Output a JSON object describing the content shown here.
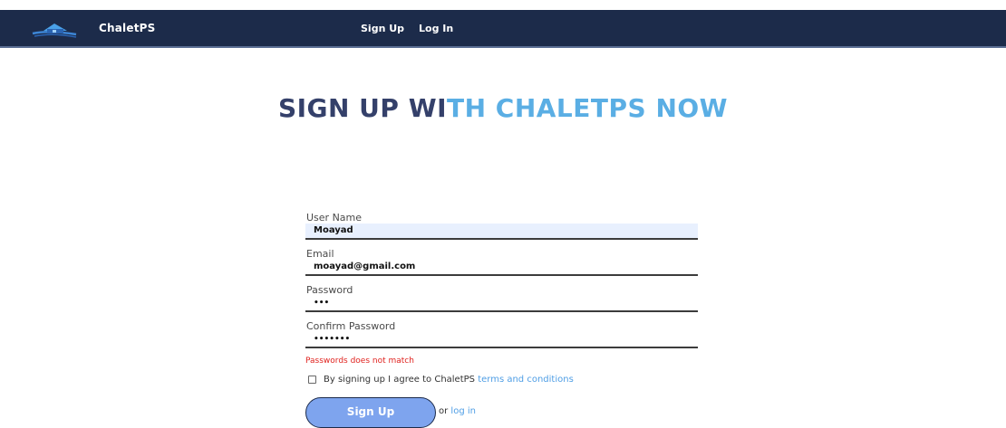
{
  "navbar": {
    "brand": "ChaletPS",
    "links": [
      "Sign Up",
      "Log In"
    ]
  },
  "hero": {
    "title_part_a": "SIGN UP WI",
    "title_part_b": "TH CHALETPS NOW"
  },
  "form": {
    "username": {
      "label": "User Name",
      "value": "Moayad"
    },
    "email": {
      "label": "Email",
      "value": "moayad@gmail.com"
    },
    "password": {
      "label": "Password",
      "value": "•••"
    },
    "confirm_password": {
      "label": "Confirm Password",
      "value": "•••••••"
    },
    "error": "Passwords does not match",
    "terms_text": "By signing up I agree to ChaletPS",
    "terms_link": "terms and conditions",
    "submit_label": "Sign Up",
    "or_text": "or",
    "login_link": "log in"
  },
  "colors": {
    "navbar_bg": "#1c2b4a",
    "title_dark": "#34406a",
    "title_light": "#5aaee4",
    "button_bg": "#7ea4ee",
    "error": "#e0231f",
    "link": "#4f9ee5"
  },
  "icons": {
    "logo": "chalet-house-logo-icon",
    "checkbox": "checkbox-unchecked-icon"
  }
}
